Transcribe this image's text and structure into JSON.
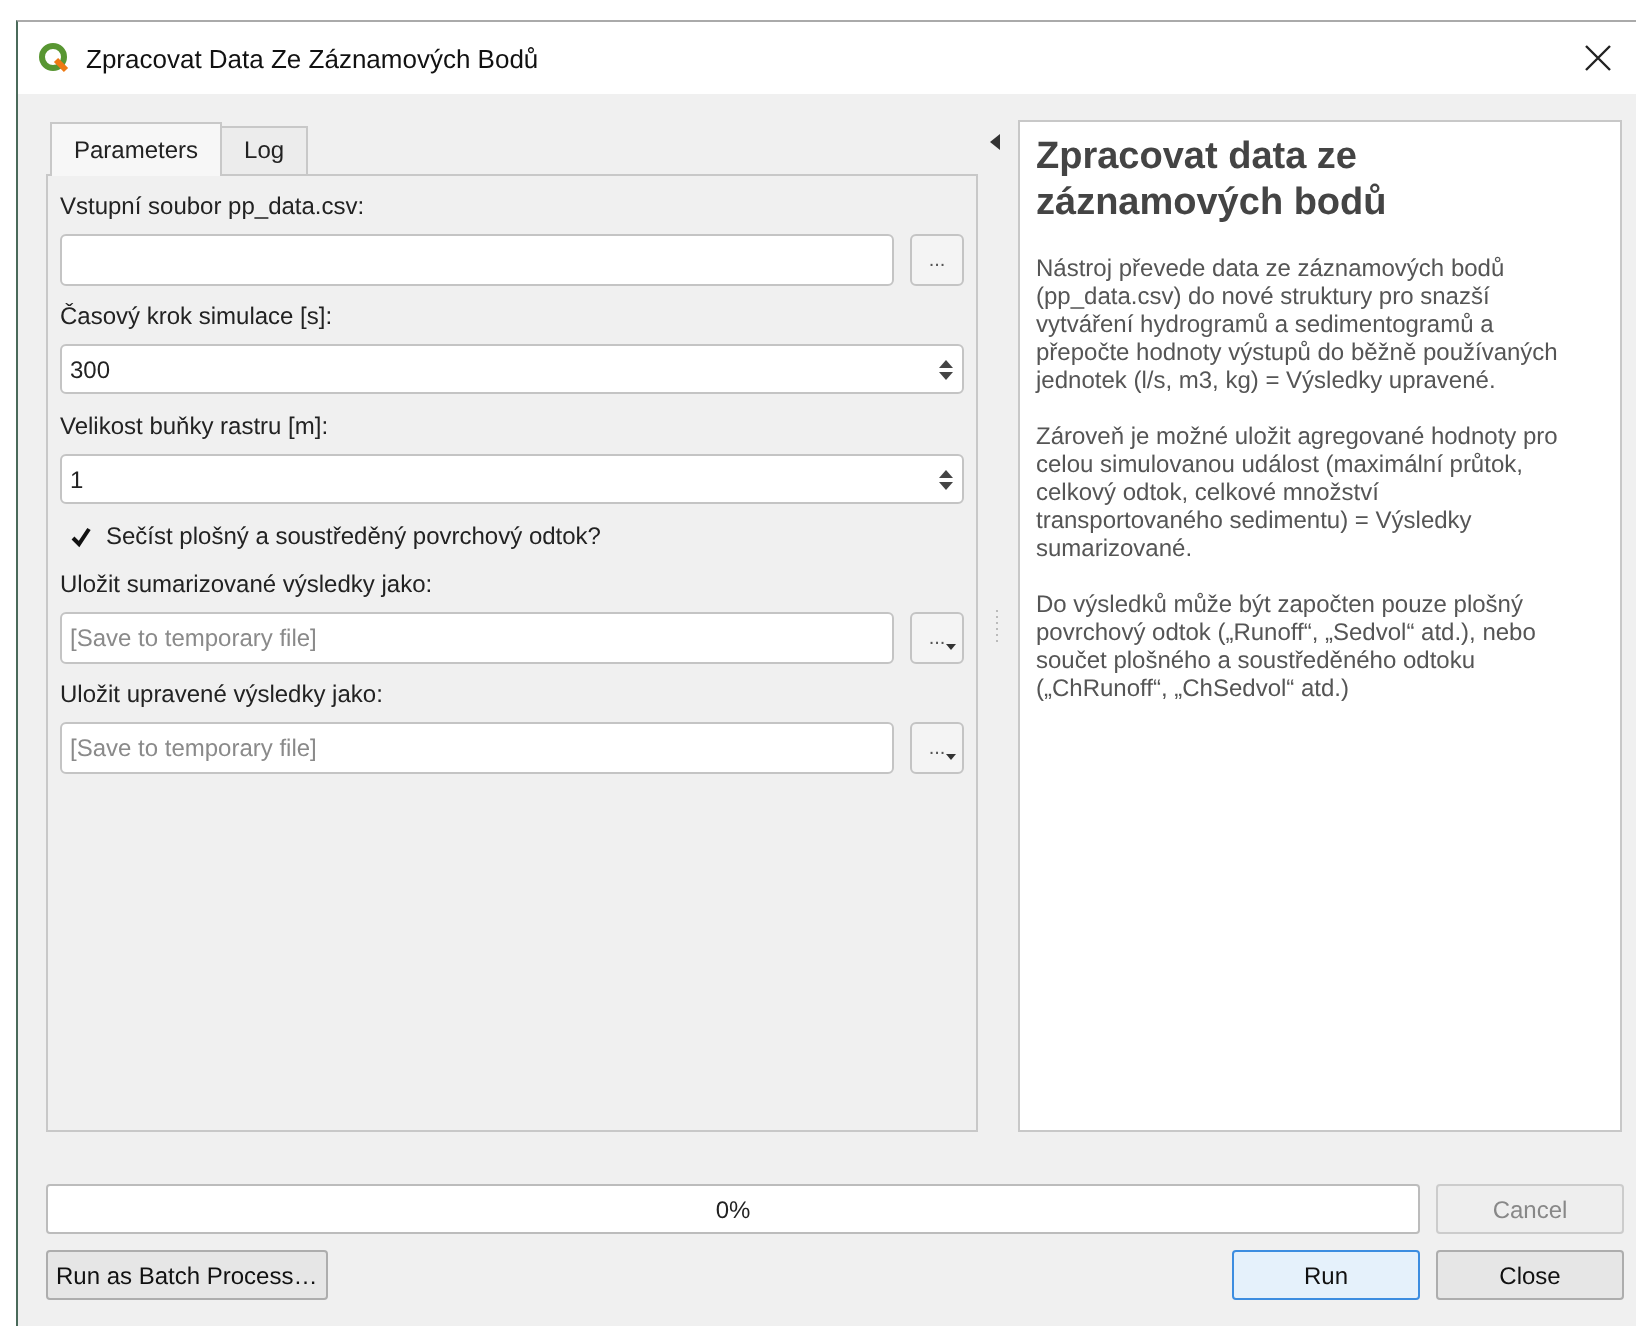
{
  "window": {
    "title": "Zpracovat Data Ze Záznamových Bodů"
  },
  "tabs": [
    {
      "label": "Parameters",
      "selected": true
    },
    {
      "label": "Log",
      "selected": false
    }
  ],
  "parameters": [
    {
      "kind": "file",
      "label": "Vstupní soubor pp_data.csv:",
      "button": "..."
    },
    {
      "kind": "spin",
      "label": "Časový krok simulace [s]:",
      "value": "300"
    },
    {
      "kind": "spin",
      "label": "Velikost buňky rastru [m]:",
      "value": "1"
    },
    {
      "kind": "checkbox",
      "label": "Sečíst plošný a soustředěný povrchový odtok?",
      "checked": true
    },
    {
      "kind": "output",
      "label": "Uložit sumarizované výsledky jako:",
      "placeholder": "[Save to temporary file]",
      "button": "..."
    },
    {
      "kind": "output",
      "label": "Uložit upravené výsledky jako:",
      "placeholder": "[Save to temporary file]",
      "button": "..."
    }
  ],
  "help": {
    "title": "Zpracovat data ze záznamových bodů",
    "paragraphs": [
      "Nástroj převede data ze záznamových bodů (pp_data.csv) do nové struktury pro snazší vytváření hydrogramů a sedimentogramů a přepočte hodnoty výstupů do běžně používaných jednotek (l/s, m3, kg) = Výsledky upravené.",
      "Zároveň je možné uložit agregované hodnoty pro celou simulovanou událost (maximální průtok, celkový odtok, celkové množství transportovaného sedimentu) = Výsledky sumarizované.",
      "Do výsledků může být započten pouze plošný povrchový odtok („Runoff“, „Sedvol“ atd.), nebo součet plošného a soustředěného odtoku („ChRunoff“, „ChSedvol“ atd.)"
    ]
  },
  "progress": {
    "level": 0,
    "reading": "0%"
  },
  "buttons": {
    "cancel": {
      "label": "Cancel",
      "disabled": true
    },
    "batch": {
      "label": "Run as Batch Process…"
    },
    "run": {
      "label": "Run",
      "default": true
    },
    "close": {
      "label": "Close"
    }
  }
}
